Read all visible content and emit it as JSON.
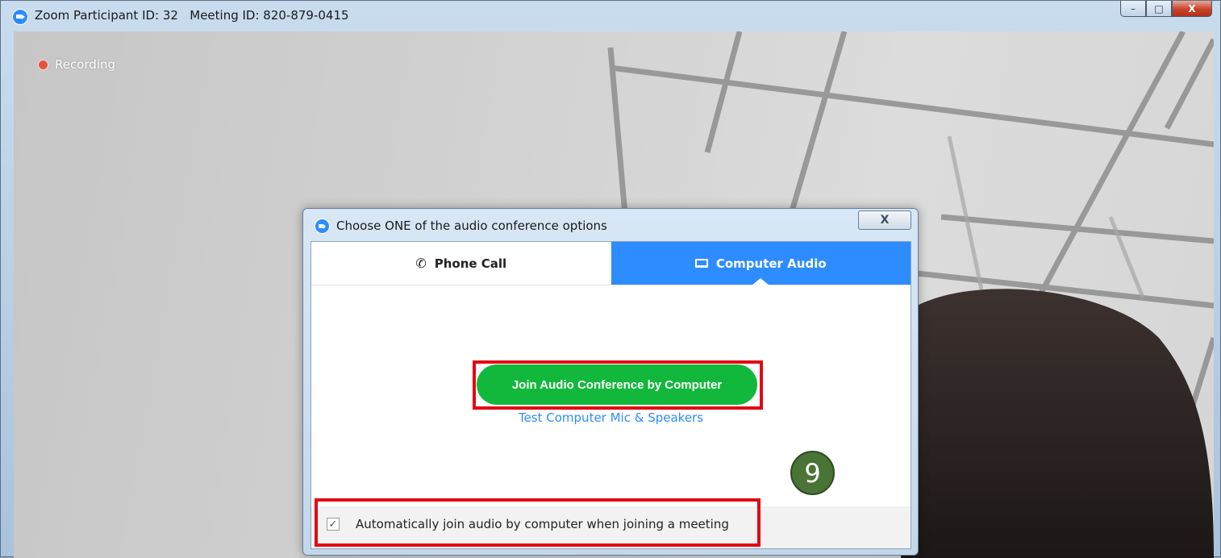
{
  "window": {
    "title": "Zoom Participant ID: 32   Meeting ID: 820-879-0415",
    "controls": {
      "minimize": "–",
      "maximize": "□",
      "close": "X"
    }
  },
  "video": {
    "recording_label": "Recording"
  },
  "dialog": {
    "title": "Choose ONE of the audio conference options",
    "close": "X",
    "tabs": [
      {
        "label": "Phone Call",
        "icon": "phone-icon",
        "active": false
      },
      {
        "label": "Computer Audio",
        "icon": "laptop-icon",
        "active": true
      }
    ],
    "join_button": "Join Audio Conference by Computer",
    "test_link": "Test Computer Mic & Speakers",
    "auto_join": {
      "checked": true,
      "label": "Automatically join audio by computer when joining a meeting"
    }
  },
  "annotation": {
    "step_number": "9",
    "highlight_color": "#e30613",
    "badge_color": "#4a7336"
  },
  "colors": {
    "zoom_blue": "#2d8cff",
    "join_green": "#12b83c"
  }
}
